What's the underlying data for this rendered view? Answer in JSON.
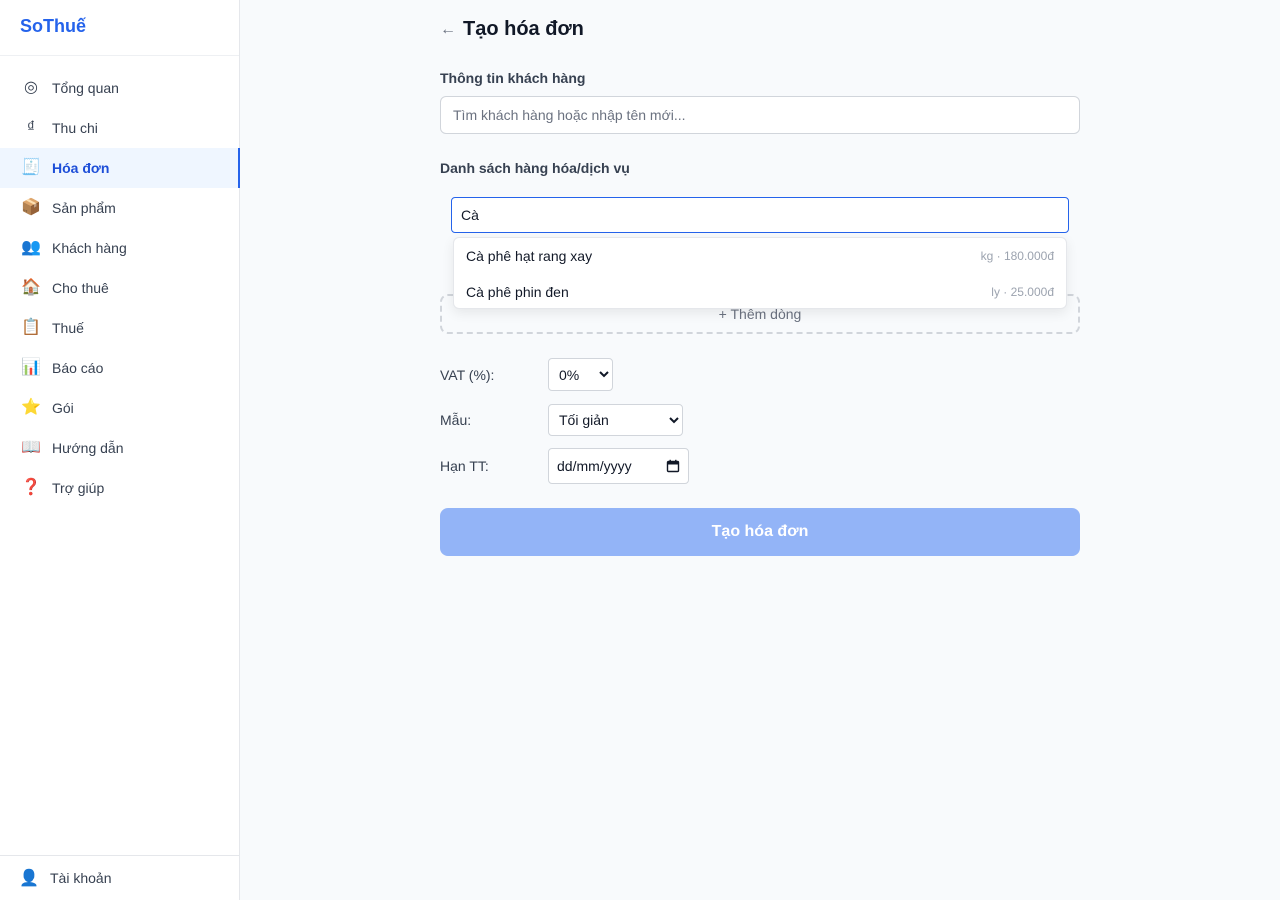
{
  "app": {
    "brand": "SoThuế"
  },
  "sidebar": {
    "items": [
      {
        "icon": "◎",
        "icon_name": "overview-icon",
        "label": "Tổng quan"
      },
      {
        "icon": "₫",
        "icon_name": "dong-icon",
        "label": "Thu chi"
      },
      {
        "icon": "🧾",
        "icon_name": "receipt-icon",
        "label": "Hóa đơn",
        "active": true
      },
      {
        "icon": "📦",
        "icon_name": "package-icon",
        "label": "Sản phẩm"
      },
      {
        "icon": "👥",
        "icon_name": "users-icon",
        "label": "Khách hàng"
      },
      {
        "icon": "🏠",
        "icon_name": "house-icon",
        "label": "Cho thuê"
      },
      {
        "icon": "📋",
        "icon_name": "clipboard-icon",
        "label": "Thuế"
      },
      {
        "icon": "📊",
        "icon_name": "bar-chart-icon",
        "label": "Báo cáo"
      },
      {
        "icon": "⭐",
        "icon_name": "star-icon",
        "label": "Gói"
      },
      {
        "icon": "📖",
        "icon_name": "book-icon",
        "label": "Hướng dẫn"
      },
      {
        "icon": "❓",
        "icon_name": "question-icon",
        "label": "Trợ giúp"
      }
    ],
    "account": {
      "icon": "👤",
      "icon_name": "user-icon",
      "label": "Tài khoản"
    }
  },
  "page": {
    "back_icon": "←",
    "title": "Tạo hóa đơn"
  },
  "customer": {
    "label": "Thông tin khách hàng",
    "placeholder": "Tìm khách hàng hoặc nhập tên mới..."
  },
  "items_section": {
    "label": "Danh sách hàng hóa/dịch vụ",
    "search_value": "Cà",
    "suggestions": [
      {
        "name": "Cà phê hạt rang xay",
        "meta": "kg · 180.000đ"
      },
      {
        "name": "Cà phê phin đen",
        "meta": "ly · 25.000đ"
      }
    ],
    "add_row_label": "+ Thêm dòng"
  },
  "form": {
    "vat": {
      "label": "VAT (%):",
      "selected": "0%"
    },
    "template": {
      "label": "Mẫu:",
      "selected": "Tối giản"
    },
    "due": {
      "label": "Hạn TT:",
      "placeholder": "dd/mm/yyyy"
    }
  },
  "submit_label": "Tạo hóa đơn",
  "colors": {
    "brand": "#2563eb",
    "active_bg": "#eff6ff",
    "submit_disabled": "#93b4f7",
    "background": "#f8fafc"
  }
}
